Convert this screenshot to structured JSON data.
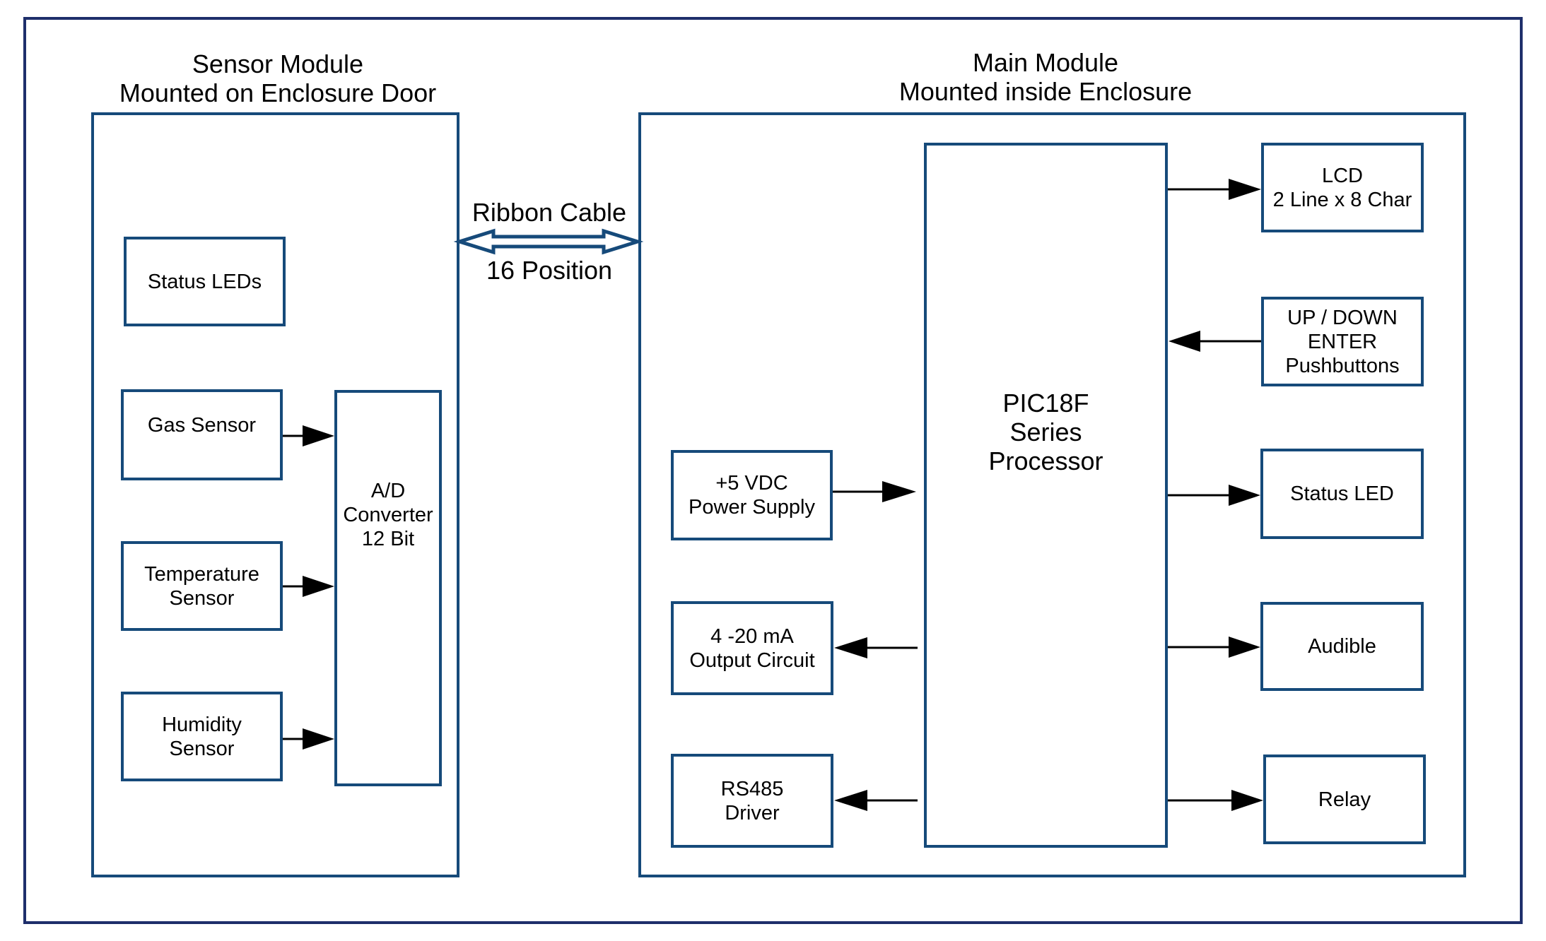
{
  "sensor_module": {
    "title_line1": "Sensor Module",
    "title_line2": "Mounted on Enclosure Door",
    "blocks": {
      "status_leds": [
        "Status LEDs"
      ],
      "gas_sensor": [
        "Gas Sensor"
      ],
      "temperature_sensor": [
        "Temperature",
        "Sensor"
      ],
      "humidity_sensor": [
        "Humidity",
        "Sensor"
      ],
      "ad_converter": [
        "A/D",
        "Converter",
        "12 Bit"
      ]
    }
  },
  "ribbon_cable": {
    "label_top": "Ribbon Cable",
    "label_bottom": "16 Position"
  },
  "main_module": {
    "title_line1": "Main Module",
    "title_line2": "Mounted inside Enclosure",
    "blocks": {
      "processor": [
        "PIC18F",
        "Series",
        "Processor"
      ],
      "power_supply": [
        "+5 VDC",
        "Power Supply"
      ],
      "output_circuit": [
        "4 -20 mA",
        "Output Circuit"
      ],
      "rs485": [
        "RS485",
        "Driver"
      ],
      "lcd": [
        "LCD",
        "2 Line x 8 Char"
      ],
      "pushbuttons": [
        "UP / DOWN",
        "ENTER",
        "Pushbuttons"
      ],
      "status_led": [
        "Status LED"
      ],
      "audible": [
        "Audible"
      ],
      "relay": [
        "Relay"
      ]
    }
  },
  "colors": {
    "outer_border": "#1e2f6b",
    "block_border": "#164a7a",
    "arrow": "#000000"
  }
}
